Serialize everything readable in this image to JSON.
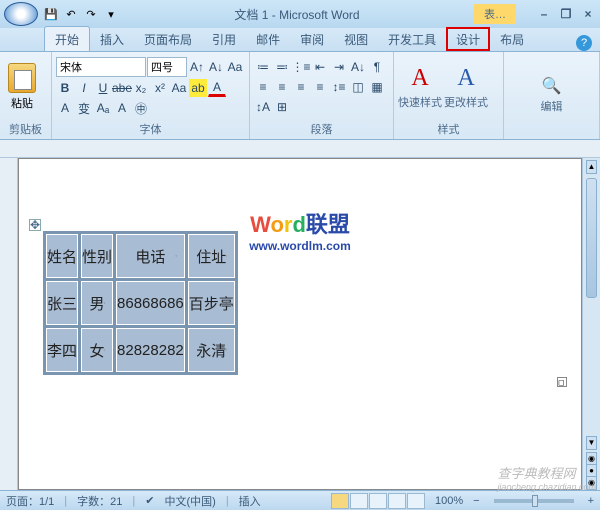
{
  "title": "文档 1 - Microsoft Word",
  "contextual_tab_header": "表…",
  "qat": {
    "save": "💾",
    "undo": "↶",
    "redo": "↷",
    "more": "▾"
  },
  "win": {
    "min": "–",
    "restore": "❐",
    "close": "×"
  },
  "tabs": [
    "开始",
    "插入",
    "页面布局",
    "引用",
    "邮件",
    "审阅",
    "视图",
    "开发工具",
    "设计",
    "布局"
  ],
  "help": "?",
  "ribbon": {
    "clipboard": {
      "paste": "粘贴",
      "label": "剪贴板"
    },
    "font": {
      "name": "宋体",
      "size": "四号",
      "label": "字体"
    },
    "paragraph": {
      "label": "段落"
    },
    "styles": {
      "quick": "快速样式",
      "change": "更改样式",
      "label": "样式"
    },
    "editing": {
      "label": "编辑"
    }
  },
  "watermark": {
    "w": "W",
    "o": "o",
    "r": "r",
    "d": "d",
    "cn": "联盟",
    "url": "www.wordlm.com"
  },
  "table": {
    "headers": [
      "姓名",
      "性别",
      "电话",
      "住址"
    ],
    "rows": [
      [
        "张三",
        "男",
        "86868686",
        "百步亭"
      ],
      [
        "李四",
        "女",
        "82828282",
        "永清"
      ]
    ]
  },
  "status": {
    "page": "页面：1/1",
    "words": "字数：21",
    "lang": "中文(中国)",
    "mode": "插入",
    "zoom": "100%",
    "minus": "−",
    "plus": "+"
  },
  "credit_main": "查字典教程网",
  "credit_sub": "jiaocheng.chazidian.com"
}
